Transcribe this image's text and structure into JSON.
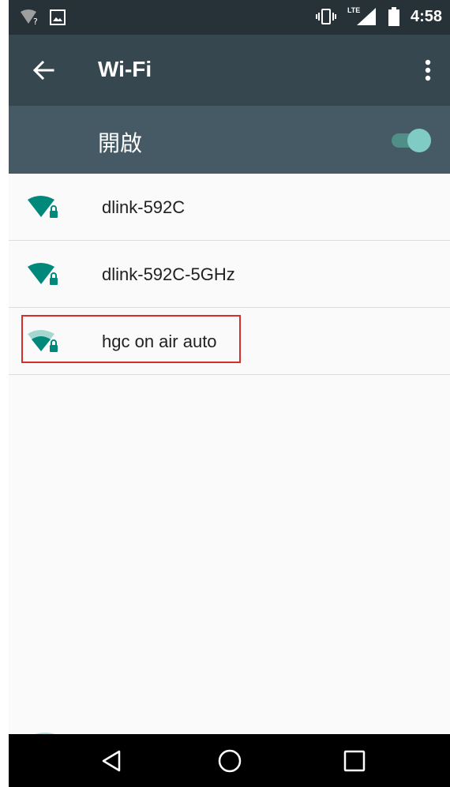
{
  "status_bar": {
    "time": "4:58",
    "icons": [
      "wifi-question-icon",
      "image-notification-icon",
      "vibrate-icon",
      "lte-signal-icon",
      "battery-icon"
    ],
    "lte_label": "LTE"
  },
  "toolbar": {
    "title": "Wi-Fi",
    "back_icon": "arrow-left-icon",
    "menu_icon": "more-vert-icon"
  },
  "wifi_switch": {
    "label": "開啟",
    "state": "on"
  },
  "networks": [
    {
      "ssid": "dlink-592C",
      "signal": "full",
      "secured": true
    },
    {
      "ssid": "dlink-592C-5GHz",
      "signal": "full",
      "secured": true
    },
    {
      "ssid": "hgc on air auto",
      "signal": "medium",
      "secured": true,
      "highlighted": true
    }
  ],
  "nav_bar": {
    "back": "back-triangle-icon",
    "home": "home-circle-icon",
    "recents": "recents-square-icon"
  },
  "colors": {
    "status_bar": "#263238",
    "toolbar": "#37474f",
    "switch_bar": "#455a64",
    "accent": "#009688",
    "highlight": "#d32f2f"
  }
}
